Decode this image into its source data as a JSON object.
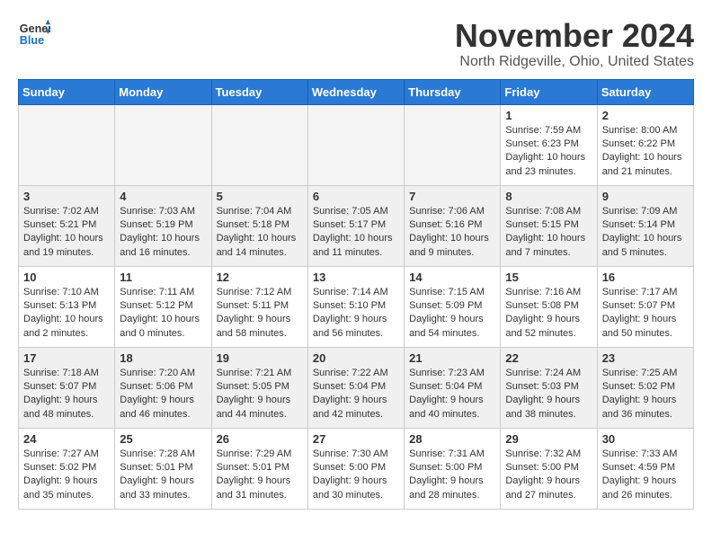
{
  "logo": {
    "line1": "General",
    "line2": "Blue"
  },
  "title": "November 2024",
  "location": "North Ridgeville, Ohio, United States",
  "days_of_week": [
    "Sunday",
    "Monday",
    "Tuesday",
    "Wednesday",
    "Thursday",
    "Friday",
    "Saturday"
  ],
  "weeks": [
    [
      {
        "day": "",
        "info": ""
      },
      {
        "day": "",
        "info": ""
      },
      {
        "day": "",
        "info": ""
      },
      {
        "day": "",
        "info": ""
      },
      {
        "day": "",
        "info": ""
      },
      {
        "day": "1",
        "info": "Sunrise: 7:59 AM\nSunset: 6:23 PM\nDaylight: 10 hours and 23 minutes."
      },
      {
        "day": "2",
        "info": "Sunrise: 8:00 AM\nSunset: 6:22 PM\nDaylight: 10 hours and 21 minutes."
      }
    ],
    [
      {
        "day": "3",
        "info": "Sunrise: 7:02 AM\nSunset: 5:21 PM\nDaylight: 10 hours and 19 minutes."
      },
      {
        "day": "4",
        "info": "Sunrise: 7:03 AM\nSunset: 5:19 PM\nDaylight: 10 hours and 16 minutes."
      },
      {
        "day": "5",
        "info": "Sunrise: 7:04 AM\nSunset: 5:18 PM\nDaylight: 10 hours and 14 minutes."
      },
      {
        "day": "6",
        "info": "Sunrise: 7:05 AM\nSunset: 5:17 PM\nDaylight: 10 hours and 11 minutes."
      },
      {
        "day": "7",
        "info": "Sunrise: 7:06 AM\nSunset: 5:16 PM\nDaylight: 10 hours and 9 minutes."
      },
      {
        "day": "8",
        "info": "Sunrise: 7:08 AM\nSunset: 5:15 PM\nDaylight: 10 hours and 7 minutes."
      },
      {
        "day": "9",
        "info": "Sunrise: 7:09 AM\nSunset: 5:14 PM\nDaylight: 10 hours and 5 minutes."
      }
    ],
    [
      {
        "day": "10",
        "info": "Sunrise: 7:10 AM\nSunset: 5:13 PM\nDaylight: 10 hours and 2 minutes."
      },
      {
        "day": "11",
        "info": "Sunrise: 7:11 AM\nSunset: 5:12 PM\nDaylight: 10 hours and 0 minutes."
      },
      {
        "day": "12",
        "info": "Sunrise: 7:12 AM\nSunset: 5:11 PM\nDaylight: 9 hours and 58 minutes."
      },
      {
        "day": "13",
        "info": "Sunrise: 7:14 AM\nSunset: 5:10 PM\nDaylight: 9 hours and 56 minutes."
      },
      {
        "day": "14",
        "info": "Sunrise: 7:15 AM\nSunset: 5:09 PM\nDaylight: 9 hours and 54 minutes."
      },
      {
        "day": "15",
        "info": "Sunrise: 7:16 AM\nSunset: 5:08 PM\nDaylight: 9 hours and 52 minutes."
      },
      {
        "day": "16",
        "info": "Sunrise: 7:17 AM\nSunset: 5:07 PM\nDaylight: 9 hours and 50 minutes."
      }
    ],
    [
      {
        "day": "17",
        "info": "Sunrise: 7:18 AM\nSunset: 5:07 PM\nDaylight: 9 hours and 48 minutes."
      },
      {
        "day": "18",
        "info": "Sunrise: 7:20 AM\nSunset: 5:06 PM\nDaylight: 9 hours and 46 minutes."
      },
      {
        "day": "19",
        "info": "Sunrise: 7:21 AM\nSunset: 5:05 PM\nDaylight: 9 hours and 44 minutes."
      },
      {
        "day": "20",
        "info": "Sunrise: 7:22 AM\nSunset: 5:04 PM\nDaylight: 9 hours and 42 minutes."
      },
      {
        "day": "21",
        "info": "Sunrise: 7:23 AM\nSunset: 5:04 PM\nDaylight: 9 hours and 40 minutes."
      },
      {
        "day": "22",
        "info": "Sunrise: 7:24 AM\nSunset: 5:03 PM\nDaylight: 9 hours and 38 minutes."
      },
      {
        "day": "23",
        "info": "Sunrise: 7:25 AM\nSunset: 5:02 PM\nDaylight: 9 hours and 36 minutes."
      }
    ],
    [
      {
        "day": "24",
        "info": "Sunrise: 7:27 AM\nSunset: 5:02 PM\nDaylight: 9 hours and 35 minutes."
      },
      {
        "day": "25",
        "info": "Sunrise: 7:28 AM\nSunset: 5:01 PM\nDaylight: 9 hours and 33 minutes."
      },
      {
        "day": "26",
        "info": "Sunrise: 7:29 AM\nSunset: 5:01 PM\nDaylight: 9 hours and 31 minutes."
      },
      {
        "day": "27",
        "info": "Sunrise: 7:30 AM\nSunset: 5:00 PM\nDaylight: 9 hours and 30 minutes."
      },
      {
        "day": "28",
        "info": "Sunrise: 7:31 AM\nSunset: 5:00 PM\nDaylight: 9 hours and 28 minutes."
      },
      {
        "day": "29",
        "info": "Sunrise: 7:32 AM\nSunset: 5:00 PM\nDaylight: 9 hours and 27 minutes."
      },
      {
        "day": "30",
        "info": "Sunrise: 7:33 AM\nSunset: 4:59 PM\nDaylight: 9 hours and 26 minutes."
      }
    ]
  ]
}
